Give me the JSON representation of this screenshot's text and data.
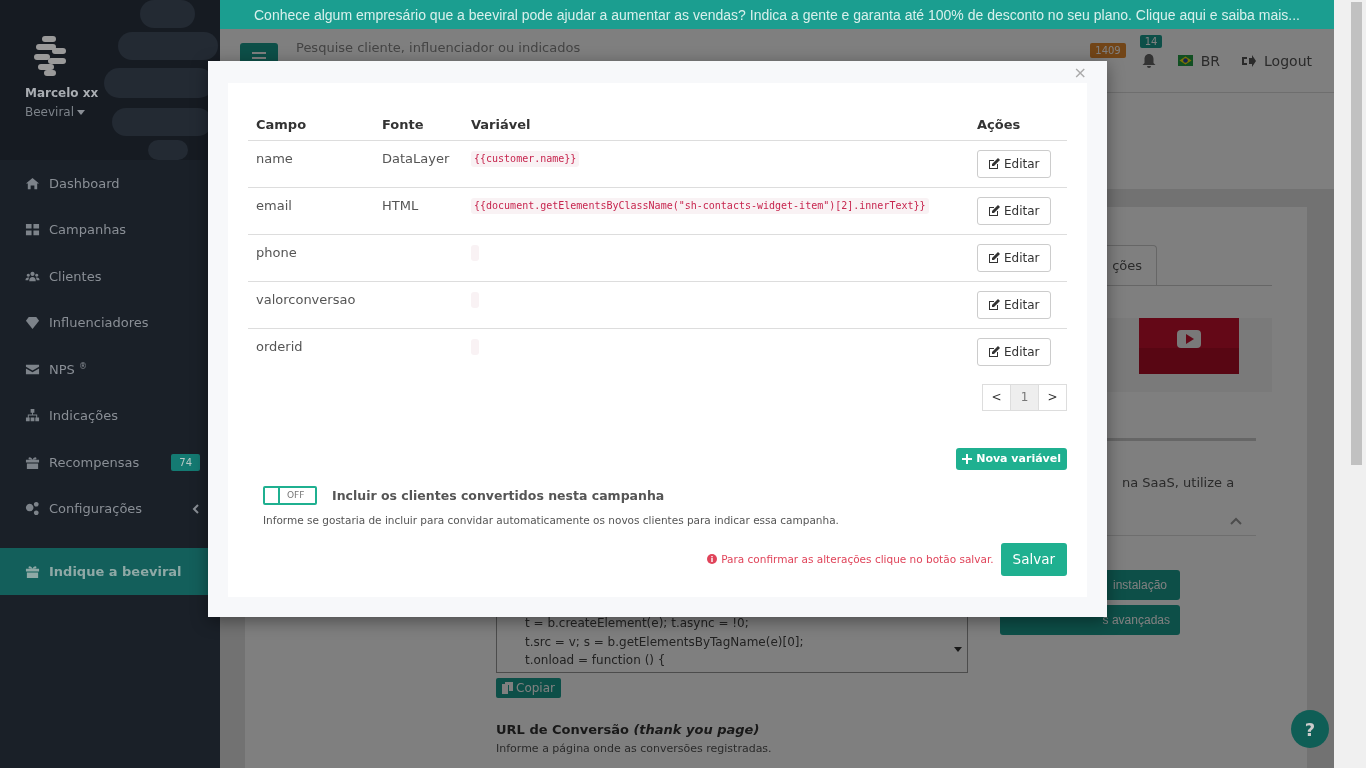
{
  "banner": {
    "text": "Conhece algum empresário que a beeviral pode ajudar a aumentar as vendas? Indica a gente e garanta até 100% de desconto no seu plano. Clique aqui e saiba mais..."
  },
  "sidebar": {
    "user": "Marcelo xx",
    "account": "Beeviral",
    "items": [
      {
        "label": "Dashboard",
        "selected": false
      },
      {
        "label": "Campanhas",
        "selected": false
      },
      {
        "label": "Clientes",
        "selected": false
      },
      {
        "label": "Influenciadores",
        "selected": false
      },
      {
        "label": "NPS $^{®}$",
        "selected": false
      },
      {
        "label": "Indicações",
        "selected": false
      },
      {
        "label": "Recompensas",
        "selected": false,
        "badge": "74"
      },
      {
        "label": "Configurações",
        "selected": false,
        "expanded": false
      }
    ],
    "highlight": {
      "label": "Indique a beeviral",
      "selected": true
    }
  },
  "header": {
    "search": {
      "placeholder": "Pesquise cliente, influenciador ou indicados"
    },
    "counter": "1409",
    "notifications": "14",
    "language": "BR",
    "logout": "Logout"
  },
  "background": {
    "tab": "ções",
    "text": "na SaaS, utilize a",
    "buttons": [
      "instalação",
      "s avançadas"
    ],
    "code_lines": [
      "t = b.createElement(e); t.async = !0;",
      "t.src = v; s = b.getElementsByTagName(e)[0];",
      "t.onload = function () {"
    ],
    "copy_button": "Copiar",
    "url_title": "URL de Conversão *(thank you page)*",
    "url_hint": "Informe a página onde as conversões registradas.",
    "help": "?"
  },
  "modal": {
    "close": "×",
    "columns": [
      "Campo",
      "Fonte",
      "Variável",
      "Ações"
    ],
    "rows": [
      {
        "field": "name",
        "source": "DataLayer",
        "variable": "{{customer.name}}",
        "action": "Editar"
      },
      {
        "field": "email",
        "source": "HTML",
        "variable": "{{document.getElementsByClassName(\"sh-contacts-widget-item\")[2].innerText}}",
        "action": "Editar"
      },
      {
        "field": "phone",
        "action": "Editar"
      },
      {
        "field": "valorconversao",
        "action": "Editar"
      },
      {
        "field": "orderid",
        "action": "Editar"
      }
    ],
    "pagination": {
      "prev": "<",
      "pages": [
        {
          "label": "1",
          "selected": true
        }
      ],
      "next": ">"
    },
    "add_button": "Nova variável",
    "toggle": {
      "on": false,
      "state_label": "OFF",
      "label": "Incluir os clientes convertidos nesta campanha",
      "hint": "Informe se gostaria de incluir para convidar automaticamente os novos clientes para indicar essa campanha."
    },
    "warning": "Para confirmar as alterações clique no botão salvar.",
    "save": "Salvar"
  }
}
